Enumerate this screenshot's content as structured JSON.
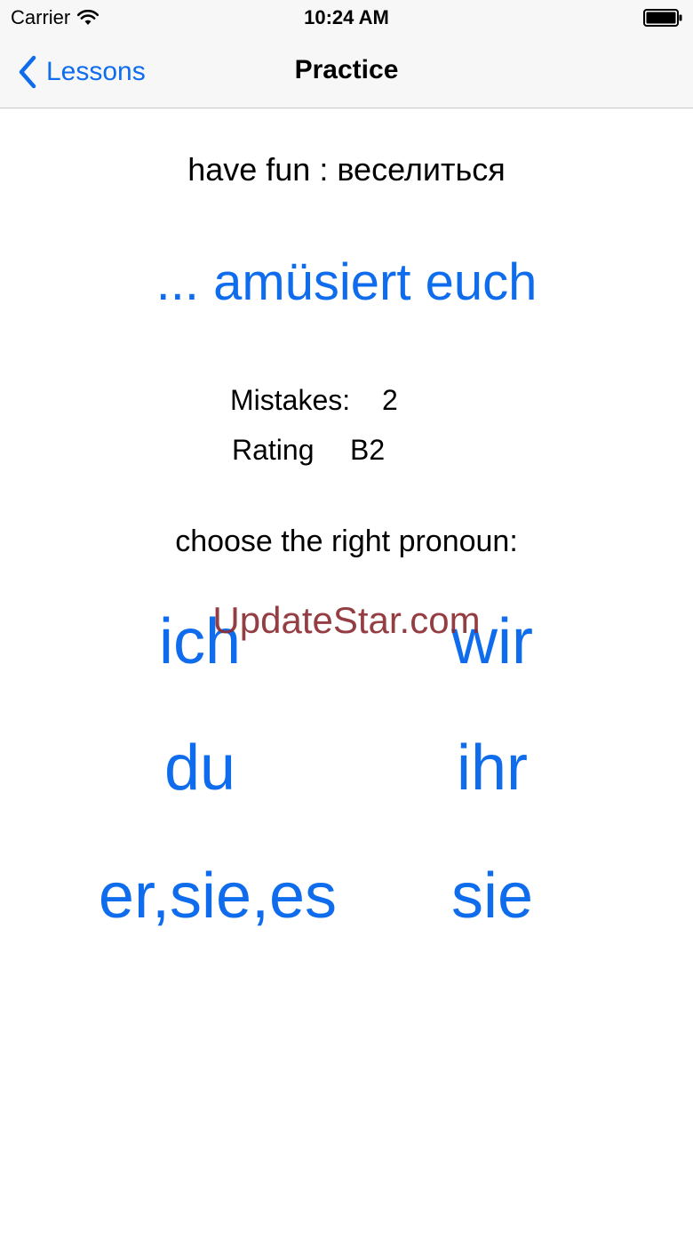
{
  "status_bar": {
    "carrier": "Carrier",
    "time": "10:24 AM",
    "wifi_icon": "wifi-icon",
    "battery_icon": "battery-icon"
  },
  "nav": {
    "back_label": "Lessons",
    "back_icon": "chevron-left-icon",
    "title": "Practice"
  },
  "translation": "have fun : веселиться",
  "verb_form": "... amüsiert euch",
  "stats": {
    "mistakes_label": "Mistakes:",
    "mistakes_value": "2",
    "rating_label": "Rating",
    "rating_value": "B2"
  },
  "instruction": "choose the right pronoun:",
  "pronouns": {
    "ich": "ich",
    "wir": "wir",
    "du": "du",
    "ihr": "ihr",
    "er_sie_es": "er,sie,es",
    "sie": "sie"
  },
  "watermark": "UpdateStar.com",
  "colors": {
    "accent": "#0f6ded",
    "watermark": "#8b2d32",
    "bar_background": "#f7f7f7"
  }
}
